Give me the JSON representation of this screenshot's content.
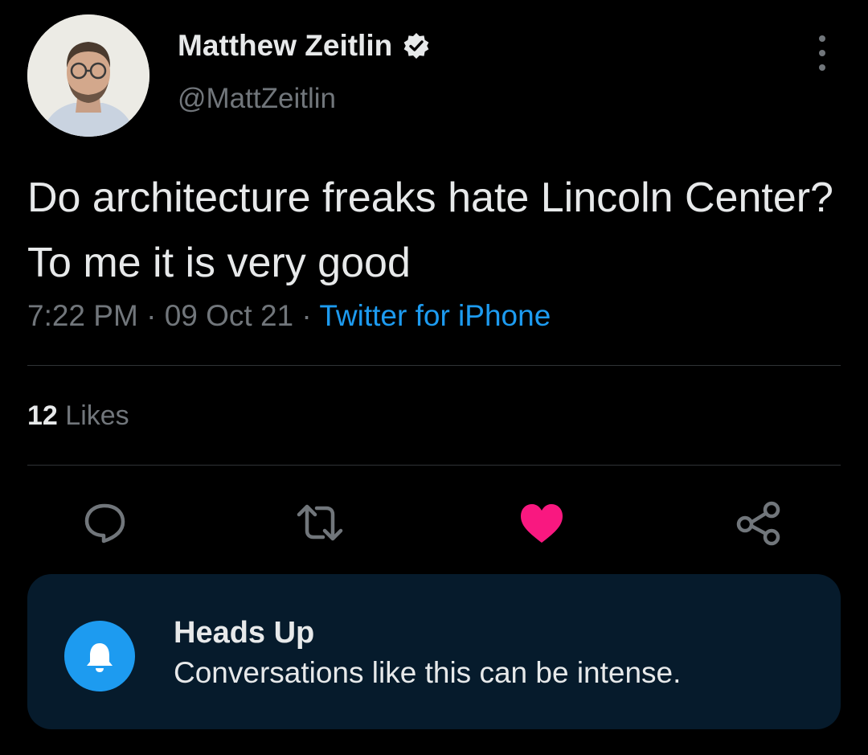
{
  "tweet": {
    "author": {
      "name": "Matthew Zeitlin",
      "handle": "@MattZeitlin",
      "verified": true,
      "avatar": "profile-photo"
    },
    "text": "Do architecture freaks hate Lincoln Center? To me it is very good",
    "time": "7:22 PM",
    "separator": "·",
    "date": "09 Oct 21",
    "source": "Twitter for iPhone",
    "likes_count": "12",
    "likes_label": "Likes",
    "liked": true
  },
  "actions": [
    {
      "name": "reply",
      "icon": "reply-icon"
    },
    {
      "name": "retweet",
      "icon": "retweet-icon"
    },
    {
      "name": "like",
      "icon": "heart-icon",
      "active": true
    },
    {
      "name": "share",
      "icon": "share-icon"
    }
  ],
  "notice": {
    "title": "Heads Up",
    "body": "Conversations like this can be intense.",
    "icon": "bell-icon"
  },
  "colors": {
    "background": "#000000",
    "text_primary": "#e7e9ea",
    "text_secondary": "#71767b",
    "accent": "#1d9bf0",
    "like": "#f91880",
    "divider": "#2f3336",
    "notice_background": "#061b2c"
  }
}
